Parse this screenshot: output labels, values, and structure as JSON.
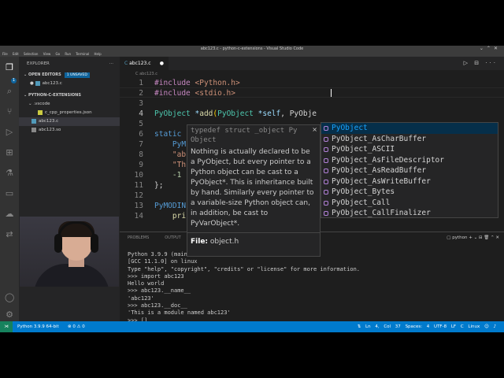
{
  "window": {
    "title": "abc123.c - python-c-extensions - Visual Studio Code"
  },
  "menu": [
    "File",
    "Edit",
    "Selection",
    "View",
    "Go",
    "Run",
    "Terminal",
    "Help"
  ],
  "explorer": {
    "header": "EXPLORER",
    "open_editors": {
      "label": "OPEN EDITORS",
      "badge": "1 UNSAVED",
      "file": "abc123.c"
    },
    "folder": {
      "label": "PYTHON-C-EXTENSIONS",
      "items": [
        {
          "name": ".vscode",
          "type": "folder"
        },
        {
          "name": "c_cpp_properties.json",
          "type": "json"
        },
        {
          "name": "abc123.c",
          "type": "c"
        },
        {
          "name": "abc123.so",
          "type": "so"
        }
      ]
    }
  },
  "editor": {
    "tab": {
      "label": "abc123.c",
      "dirty": "●"
    },
    "breadcrumb": "C abc123.c",
    "lines": [
      {
        "no": "1",
        "code": "#include <Python.h>"
      },
      {
        "no": "2",
        "code": "#include <stdio.h>"
      },
      {
        "no": "3",
        "code": ""
      },
      {
        "no": "4",
        "code": "PyObject *add(PyObject *self, PyObje"
      },
      {
        "no": "5",
        "code": ""
      },
      {
        "no": "6",
        "code": "static"
      },
      {
        "no": "7",
        "code": "    PyM"
      },
      {
        "no": "8",
        "code": "    \"ab"
      },
      {
        "no": "9",
        "code": "    \"Th"
      },
      {
        "no": "10",
        "code": "    -1"
      },
      {
        "no": "11",
        "code": "};"
      },
      {
        "no": "12",
        "code": ""
      },
      {
        "no": "13",
        "code": "PyMODIN"
      },
      {
        "no": "14",
        "code": "    pri"
      }
    ]
  },
  "hover": {
    "signature": "typedef struct _object Py Object",
    "close": "×",
    "doc": "Nothing is actually declared to be a PyObject, but every pointer to a Python object can be cast to a PyObject*. This is inheritance built by hand. Similarly every pointer to a variable-size Python object can, in addition, be cast to PyVarObject*.",
    "file_label": "File:",
    "file": "object.h"
  },
  "suggest": {
    "match": "PyObje",
    "items": [
      "PyObject",
      "PyObject_AsCharBuffer",
      "PyObject_ASCII",
      "PyObject_AsFileDescriptor",
      "PyObject_AsReadBuffer",
      "PyObject_AsWriteBuffer",
      "PyObject_Bytes",
      "PyObject_Call",
      "PyObject_CallFinalizer"
    ]
  },
  "panel": {
    "tabs": [
      "PROBLEMS",
      "OUTPUT",
      "DEBUG CONSOLE",
      "TERMINAL"
    ],
    "terminal_name": "python",
    "lines": [
      "Python 3.9.9 (main, ...",
      "[GCC 11.1.0] on linux",
      "Type \"help\", \"copyright\", \"credits\" or \"license\" for more information.",
      ">>> import abc123",
      "Hello world",
      ">>> abc123.__name__",
      "'abc123'",
      ">>> abc123.__doc__",
      "'This is a module named abc123'",
      ">>> []"
    ]
  },
  "status": {
    "interpreter": "Python 3.9.9 64-bit",
    "problems": "⊗ 0 ⚠ 0",
    "position": "Ln 4, Col 37",
    "spaces": "Spaces: 4",
    "encoding": "UTF-8",
    "eol": "LF",
    "lang": "C",
    "os": "Linux"
  },
  "colors": {
    "status_bar": "#007acc",
    "editor_bg": "#1e1e1e",
    "sidebar_bg": "#252526",
    "activity_bg": "#333333"
  }
}
